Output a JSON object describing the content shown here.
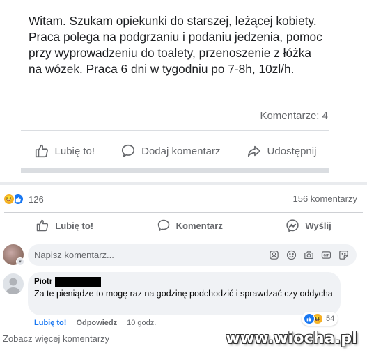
{
  "post": {
    "text": "Witam. Szukam opiekunki do starszej, leżącej kobiety. Praca polega na podgrzaniu i podaniu jedzenia, pomoc przy wyprowadzeniu do toalety, przenoszenie z łóżka na wózek. Praca 6 dni w tygodniu po 7-8h, 10zl/h.",
    "comments_count": "Komentarze: 4",
    "actions": {
      "like": "Lubię to!",
      "comment": "Dodaj komentarz",
      "share": "Udostępnij"
    }
  },
  "summary": {
    "reaction_count": "126",
    "comment_count": "156 komentarzy"
  },
  "actions": {
    "like": "Lubię to!",
    "comment": "Komentarz",
    "send": "Wyślij"
  },
  "composer": {
    "placeholder": "Napisz komentarz..."
  },
  "comment": {
    "author": "Piotr",
    "text": "Za te pieniądze to mogę raz na godzinę podchodzić i sprawdzać czy oddycha",
    "like_label": "Lubię to!",
    "reply_label": "Odpowiedz",
    "time": "10 godz.",
    "reaction_count": "54"
  },
  "see_more": "Zobacz więcej komentarzy",
  "watermark": "www.wiocha.pl",
  "colors": {
    "accent": "#1877f2",
    "muted_text": "#65676b",
    "bubble": "#f0f2f5"
  }
}
